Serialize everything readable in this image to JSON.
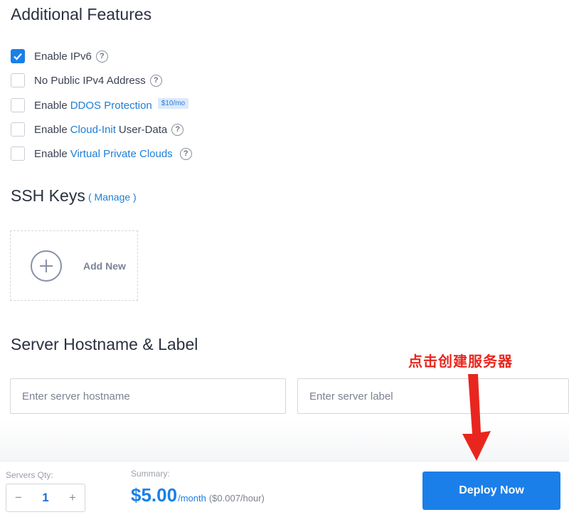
{
  "additional_features": {
    "title": "Additional Features",
    "items": [
      {
        "prefix": "Enable IPv6",
        "link": "",
        "suffix": "",
        "checked": true,
        "help": true,
        "badge": ""
      },
      {
        "prefix": "No Public IPv4 Address",
        "link": "",
        "suffix": "",
        "checked": false,
        "help": true,
        "badge": ""
      },
      {
        "prefix": "Enable",
        "link": "DDOS Protection",
        "suffix": "",
        "checked": false,
        "help": false,
        "badge": "$10/mo"
      },
      {
        "prefix": "Enable",
        "link": "Cloud-Init",
        "suffix": "User-Data",
        "checked": false,
        "help": true,
        "badge": ""
      },
      {
        "prefix": "Enable",
        "link": "Virtual Private Clouds",
        "suffix": "",
        "checked": false,
        "help": true,
        "badge": ""
      }
    ],
    "help_glyph": "?"
  },
  "ssh_keys": {
    "title": "SSH Keys",
    "manage_label": "( Manage )",
    "add_new_label": "Add New"
  },
  "hostname": {
    "title": "Server Hostname & Label",
    "hostname_placeholder": "Enter server hostname",
    "label_placeholder": "Enter server label"
  },
  "annotation": {
    "text": "点击创建服务器",
    "color": "#e8261e"
  },
  "footer": {
    "qty_label": "Servers Qty:",
    "qty_value": "1",
    "minus": "−",
    "plus": "+",
    "summary_label": "Summary:",
    "price": "$5.00",
    "price_unit": "/month",
    "price_hourly": "($0.007/hour)",
    "deploy_label": "Deploy Now"
  },
  "colors": {
    "accent": "#1a7fe9",
    "link": "#1e7ed6"
  }
}
